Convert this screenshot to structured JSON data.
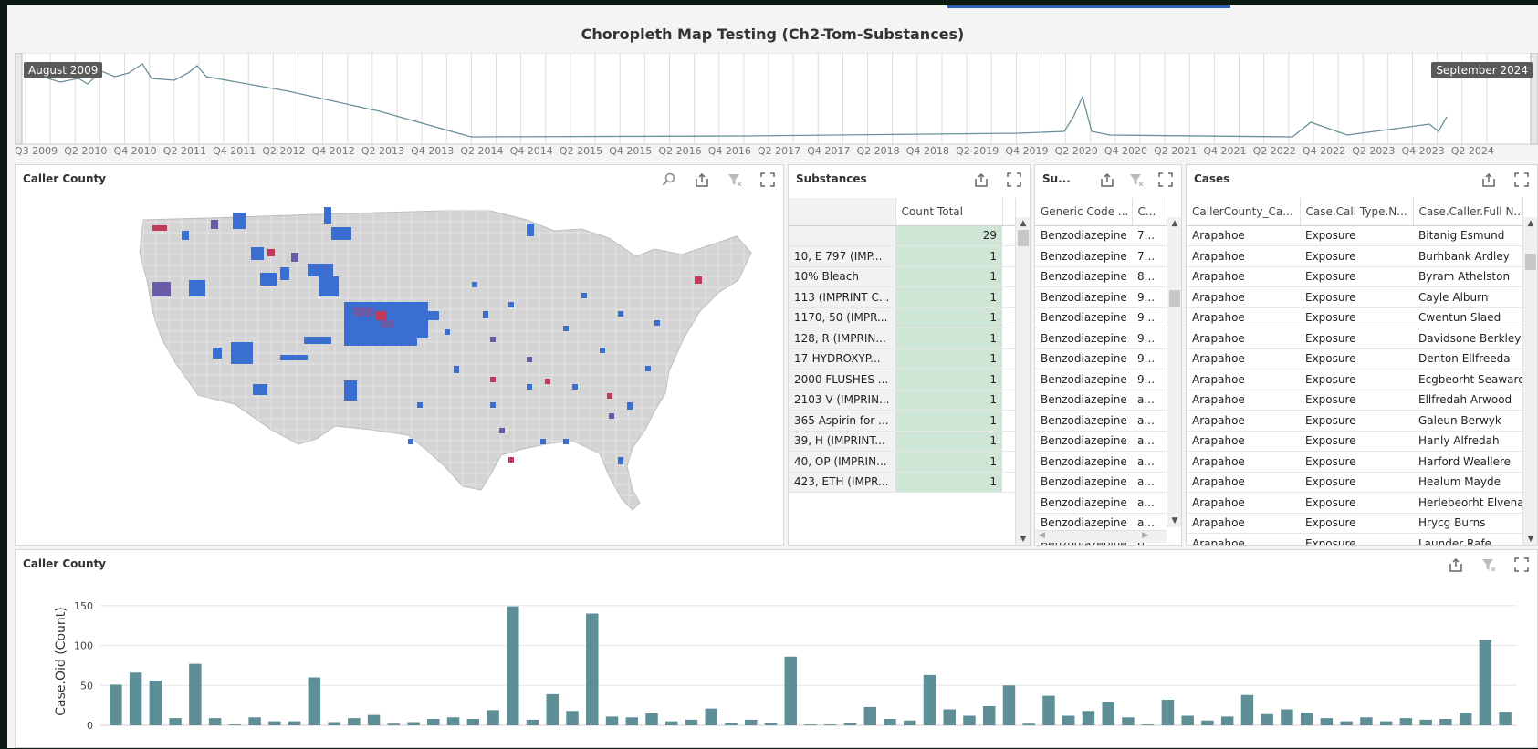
{
  "title": "Choropleth Map Testing (Ch2-Tom-Substances)",
  "range": {
    "start_label": "August 2009",
    "end_label": "September 2024",
    "ticks": [
      "Q3 2009",
      "Q2 2010",
      "Q4 2010",
      "Q2 2011",
      "Q4 2011",
      "Q2 2012",
      "Q4 2012",
      "Q2 2013",
      "Q4 2013",
      "Q2 2014",
      "Q4 2014",
      "Q2 2015",
      "Q4 2015",
      "Q2 2016",
      "Q4 2016",
      "Q2 2017",
      "Q4 2017",
      "Q2 2018",
      "Q4 2018",
      "Q2 2019",
      "Q4 2019",
      "Q2 2020",
      "Q4 2020",
      "Q2 2021",
      "Q4 2021",
      "Q2 2022",
      "Q4 2022",
      "Q2 2023",
      "Q4 2023",
      "Q2 2024"
    ]
  },
  "map_panel": {
    "title": "Caller County",
    "colors": {
      "base": "#d4d4d4",
      "low": "#3a6fd1",
      "mid": "#6a5aa8",
      "high": "#c23a5a"
    }
  },
  "substances": {
    "title": "Substances",
    "header": "Count Total",
    "total": "29",
    "rows": [
      {
        "name": "10, E 797 (IMP...",
        "count": "1"
      },
      {
        "name": "10% Bleach",
        "count": "1"
      },
      {
        "name": "113 (IMPRINT C...",
        "count": "1"
      },
      {
        "name": "1170, 50 (IMPR...",
        "count": "1"
      },
      {
        "name": "128, R (IMPRIN...",
        "count": "1"
      },
      {
        "name": "17-HYDROXYP...",
        "count": "1"
      },
      {
        "name": "2000 FLUSHES ...",
        "count": "1"
      },
      {
        "name": "2103 V (IMPRIN...",
        "count": "1"
      },
      {
        "name": "365 Aspirin for ...",
        "count": "1"
      },
      {
        "name": "39, H (IMPRINT...",
        "count": "1"
      },
      {
        "name": "40, OP (IMPRIN...",
        "count": "1"
      },
      {
        "name": "423, ETH (IMPR...",
        "count": "1"
      }
    ]
  },
  "su_panel": {
    "title": "Su...",
    "headers": [
      "Generic Code ...",
      "C..."
    ],
    "rows": [
      [
        "Benzodiazepine",
        "7..."
      ],
      [
        "Benzodiazepine",
        "7..."
      ],
      [
        "Benzodiazepine",
        "8..."
      ],
      [
        "Benzodiazepine",
        "9..."
      ],
      [
        "Benzodiazepine",
        "9..."
      ],
      [
        "Benzodiazepine",
        "9..."
      ],
      [
        "Benzodiazepine",
        "9..."
      ],
      [
        "Benzodiazepine",
        "9..."
      ],
      [
        "Benzodiazepine",
        "a..."
      ],
      [
        "Benzodiazepine",
        "a..."
      ],
      [
        "Benzodiazepine",
        "a..."
      ],
      [
        "Benzodiazepine",
        "a..."
      ],
      [
        "Benzodiazepine",
        "a..."
      ],
      [
        "Benzodiazepine",
        "a..."
      ],
      [
        "Benzodiazepine",
        "a..."
      ],
      [
        "Benzodiazepine",
        "b..."
      ]
    ]
  },
  "cases": {
    "title": "Cases",
    "headers": [
      "CallerCounty_Ca...",
      "Case.Call Type.N...",
      "Case.Caller.Full N..."
    ],
    "rows": [
      [
        "Arapahoe",
        "Exposure",
        "Bitanig Esmund"
      ],
      [
        "Arapahoe",
        "Exposure",
        "Burhbank Ardley"
      ],
      [
        "Arapahoe",
        "Exposure",
        "Byram Athelston"
      ],
      [
        "Arapahoe",
        "Exposure",
        "Cayle Alburn"
      ],
      [
        "Arapahoe",
        "Exposure",
        "Cwentun Slaed"
      ],
      [
        "Arapahoe",
        "Exposure",
        "Davidsone Berkley"
      ],
      [
        "Arapahoe",
        "Exposure",
        "Denton Ellfreeda"
      ],
      [
        "Arapahoe",
        "Exposure",
        "Ecgbeorht Seaward"
      ],
      [
        "Arapahoe",
        "Exposure",
        "Ellfredah Arwood"
      ],
      [
        "Arapahoe",
        "Exposure",
        "Galeun Berwyk"
      ],
      [
        "Arapahoe",
        "Exposure",
        "Hanly Alfredah"
      ],
      [
        "Arapahoe",
        "Exposure",
        "Harford Weallere"
      ],
      [
        "Arapahoe",
        "Exposure",
        "Healum Mayde"
      ],
      [
        "Arapahoe",
        "Exposure",
        "Herlebeorht Elvena"
      ],
      [
        "Arapahoe",
        "Exposure",
        "Hrycg Burns"
      ],
      [
        "Arapahoe",
        "Exposure",
        "Launder Rafe"
      ]
    ]
  },
  "bar_panel": {
    "title": "Caller County"
  },
  "chart_data": {
    "type": "bar",
    "ylabel": "Case.Oid (Count)",
    "ylim": [
      0,
      160
    ],
    "yticks": [
      0,
      50,
      100,
      150
    ],
    "values": [
      51,
      66,
      56,
      9,
      77,
      9,
      1,
      10,
      5,
      5,
      60,
      4,
      9,
      13,
      2,
      4,
      8,
      10,
      8,
      19,
      149,
      7,
      39,
      18,
      140,
      11,
      10,
      15,
      5,
      7,
      21,
      3,
      7,
      3,
      86,
      1,
      1,
      3,
      23,
      8,
      6,
      63,
      20,
      12,
      24,
      50,
      2,
      37,
      12,
      18,
      29,
      10,
      1,
      32,
      12,
      6,
      11,
      38,
      14,
      20,
      16,
      9,
      5,
      10,
      5,
      9,
      7,
      8,
      16,
      107,
      17
    ],
    "color": "#5f8f96"
  }
}
